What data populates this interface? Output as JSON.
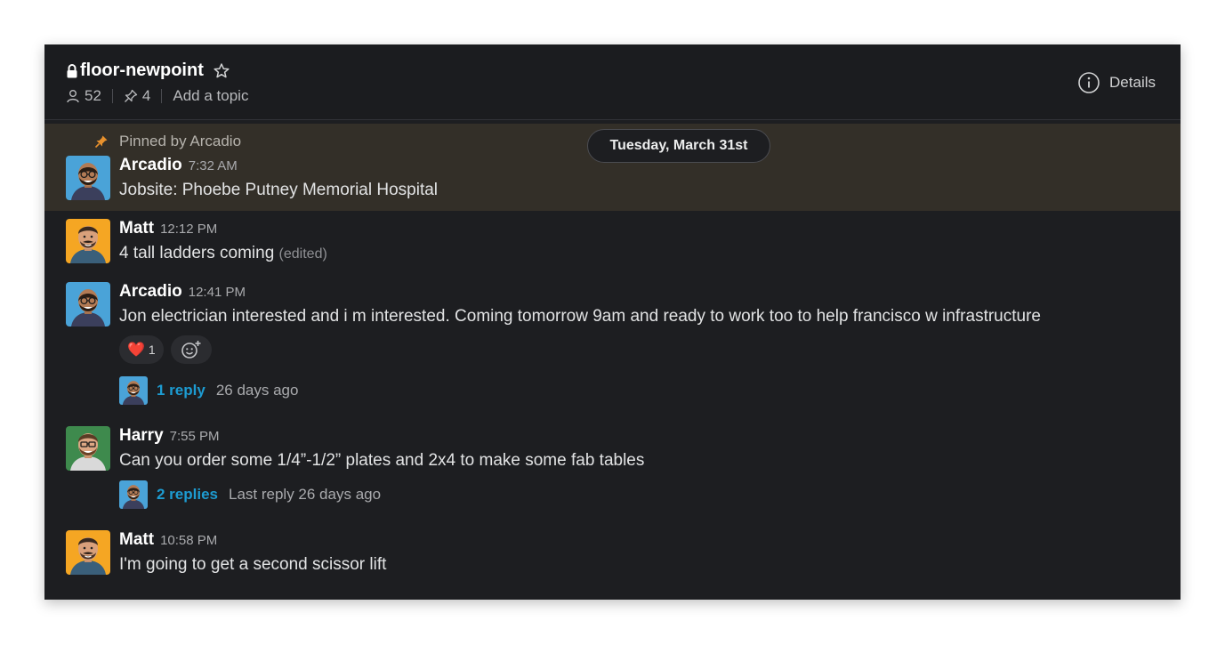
{
  "channel": {
    "name": "floor-newpoint",
    "member_count": "52",
    "pin_count": "4",
    "topic_placeholder": "Add a topic",
    "details_label": "Details"
  },
  "pinned": {
    "label": "Pinned by Arcadio"
  },
  "date_divider": "Tuesday, March 31st",
  "messages": [
    {
      "author": "Arcadio",
      "time": "7:32 AM",
      "text": "Jobsite: Phoebe Putney Memorial Hospital"
    },
    {
      "author": "Matt",
      "time": "12:12 PM",
      "text": "4 tall ladders coming",
      "edited": "(edited)"
    },
    {
      "author": "Arcadio",
      "time": "12:41 PM",
      "text": "Jon electrician interested and i m interested. Coming tomorrow 9am and ready to work too to help francisco w infrastructure",
      "reaction": {
        "emoji": "❤️",
        "count": "1"
      },
      "thread": {
        "replies": "1 reply",
        "meta": "26 days ago"
      }
    },
    {
      "author": "Harry",
      "time": "7:55 PM",
      "text": "Can you order some 1/4”-1/2” plates and 2x4 to make some fab tables",
      "thread": {
        "replies": "2 replies",
        "meta": "Last reply 26 days ago"
      }
    },
    {
      "author": "Matt",
      "time": "10:58 PM",
      "text": "I'm going to get a second scissor lift"
    }
  ],
  "colors": {
    "background": "#1d1e21",
    "pinned_background": "#332f28",
    "link": "#1d9bd1",
    "pin_accent": "#e8912d"
  }
}
